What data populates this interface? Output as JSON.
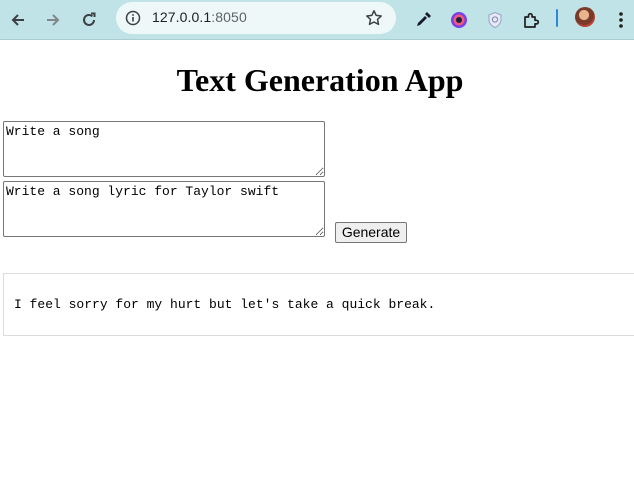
{
  "browser": {
    "url_host": "127.0.0.1",
    "url_port": ":8050",
    "icons": [
      "back-icon",
      "forward-icon",
      "reload-icon",
      "site-info-icon",
      "bookmark-star-icon",
      "eyedropper-icon",
      "extension-color-icon",
      "extension-shield-icon",
      "extensions-puzzle-icon",
      "profile-avatar",
      "menu-kebab-icon"
    ],
    "colors": {
      "toolbar": "#bfe3e6",
      "omnibox": "#eef8f8",
      "divider": "#2f86d6"
    }
  },
  "page": {
    "title": "Text Generation App",
    "prompt_value": "Write a song",
    "context_value": "Write a song lyric for Taylor swift",
    "generate_label": "Generate",
    "output_text": "I feel sorry for my hurt but let's take a quick break."
  }
}
